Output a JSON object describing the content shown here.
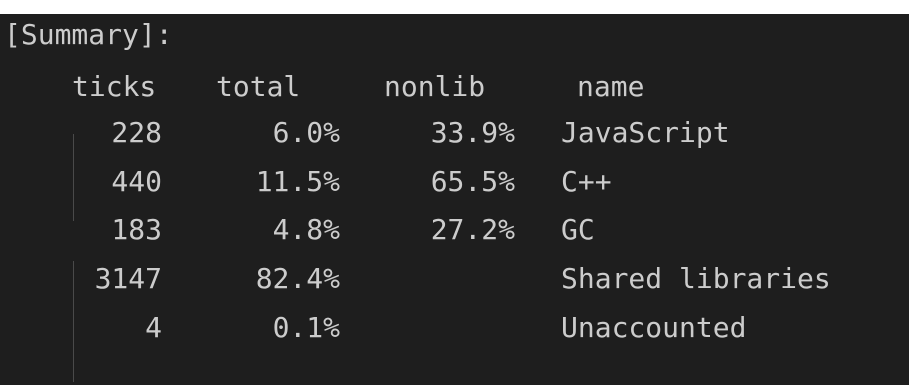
{
  "summary_label": "[Summary]:",
  "headers": {
    "ticks": "ticks",
    "total": "total",
    "nonlib": "nonlib",
    "name": "name"
  },
  "rows": [
    {
      "ticks": "228",
      "total": "6.0%",
      "nonlib": "33.9%",
      "name": "JavaScript"
    },
    {
      "ticks": "440",
      "total": "11.5%",
      "nonlib": "65.5%",
      "name": "C++"
    },
    {
      "ticks": "183",
      "total": "4.8%",
      "nonlib": "27.2%",
      "name": "GC"
    },
    {
      "ticks": "3147",
      "total": "82.4%",
      "nonlib": "",
      "name": "Shared libraries"
    },
    {
      "ticks": "4",
      "total": "0.1%",
      "nonlib": "",
      "name": "Unaccounted"
    }
  ],
  "colors": {
    "background": "#1e1e1e",
    "text": "#cccccc",
    "indent_guide": "#4a4a4a"
  }
}
